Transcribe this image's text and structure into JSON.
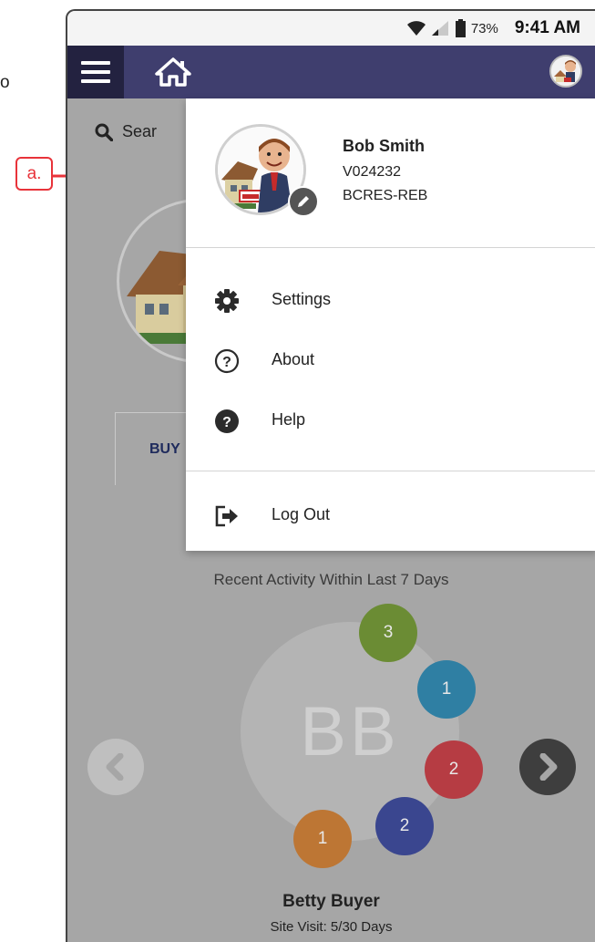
{
  "annotation": {
    "partial_left_text": "o",
    "callout_label": "a.",
    "callout_color": "#e8333a"
  },
  "status_bar": {
    "battery_percent": "73%",
    "time": "9:41 AM",
    "icons": [
      "wifi-icon",
      "signal-icon",
      "battery-icon"
    ]
  },
  "header": {
    "menu_icon": "hamburger-icon",
    "home_icon": "home-icon",
    "background_color": "#3f3e6e",
    "menu_background_color": "#232240"
  },
  "background": {
    "search_placeholder": "Sear",
    "tab_label": "BUY",
    "activity_title": "Recent Activity Within Last 7 Days",
    "contact_initials": "BB",
    "contact_name": "Betty Buyer",
    "contact_subtitle": "Site Visit: 5/30 Days",
    "activity_bubbles": [
      {
        "count": "3",
        "color": "#6b8c34"
      },
      {
        "count": "1",
        "color": "#2f7fa3"
      },
      {
        "count": "2",
        "color": "#b63c43"
      },
      {
        "count": "2",
        "color": "#3a468f"
      },
      {
        "count": "1",
        "color": "#bd7634"
      }
    ]
  },
  "drawer": {
    "profile": {
      "name": "Bob Smith",
      "id": "V024232",
      "board": "BCRES-REB"
    },
    "menu_items": [
      {
        "label": "Settings",
        "icon": "gear-icon"
      },
      {
        "label": "About",
        "icon": "question-circle-outline-icon"
      },
      {
        "label": "Help",
        "icon": "question-circle-filled-icon"
      }
    ],
    "logout": {
      "label": "Log Out",
      "icon": "logout-icon"
    }
  }
}
